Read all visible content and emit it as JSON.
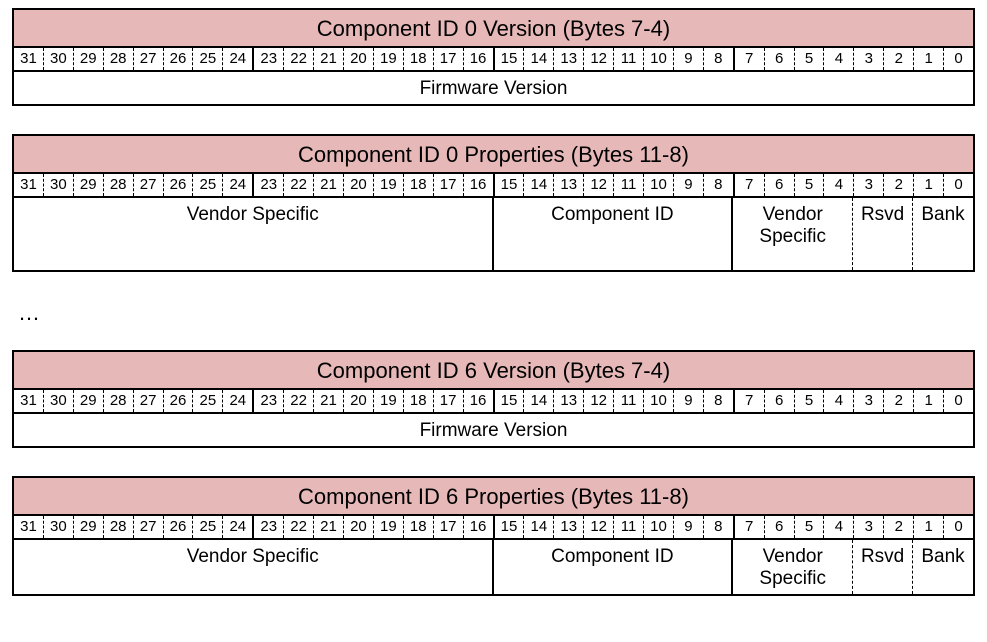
{
  "regs": [
    {
      "title": "Component ID 0 Version (Bytes 7-4)",
      "fields": [
        {
          "label": "Firmware Version",
          "cls": "w32",
          "tall": false,
          "dash": false
        }
      ],
      "tall": false
    },
    {
      "title": "Component ID 0 Properties (Bytes 11-8)",
      "fields": [
        {
          "label": "Vendor Specific",
          "cls": "w16",
          "tall": true,
          "dash": false
        },
        {
          "label": "Component ID",
          "cls": "w8",
          "tall": true,
          "dash": false
        },
        {
          "label": "Vendor Specific",
          "cls": "w4",
          "tall": true,
          "dash": true
        },
        {
          "label": "Rsvd",
          "cls": "w2",
          "tall": true,
          "dash": true
        },
        {
          "label": "Bank",
          "cls": "w2",
          "tall": true,
          "dash": false
        }
      ],
      "tall": true
    }
  ],
  "regs2": [
    {
      "title": "Component ID 6 Version (Bytes 7-4)",
      "fields": [
        {
          "label": "Firmware Version",
          "cls": "w32",
          "tall": false,
          "dash": false
        }
      ],
      "tall": false
    },
    {
      "title": "Component ID 6 Properties (Bytes 11-8)",
      "fields": [
        {
          "label": "Vendor Specific",
          "cls": "w16",
          "tall": false,
          "dash": false
        },
        {
          "label": "Component ID",
          "cls": "w8",
          "tall": false,
          "dash": false
        },
        {
          "label": "Vendor Specific",
          "cls": "w4",
          "tall": false,
          "dash": true
        },
        {
          "label": "Rsvd",
          "cls": "w2",
          "tall": false,
          "dash": true
        },
        {
          "label": "Bank",
          "cls": "w2",
          "tall": false,
          "dash": false
        }
      ],
      "tall": false
    }
  ],
  "bits": [
    "31",
    "30",
    "29",
    "28",
    "27",
    "26",
    "25",
    "24",
    "23",
    "22",
    "21",
    "20",
    "19",
    "18",
    "17",
    "16",
    "15",
    "14",
    "13",
    "12",
    "11",
    "10",
    "9",
    "8",
    "7",
    "6",
    "5",
    "4",
    "3",
    "2",
    "1",
    "0"
  ],
  "ellipsis": "…"
}
